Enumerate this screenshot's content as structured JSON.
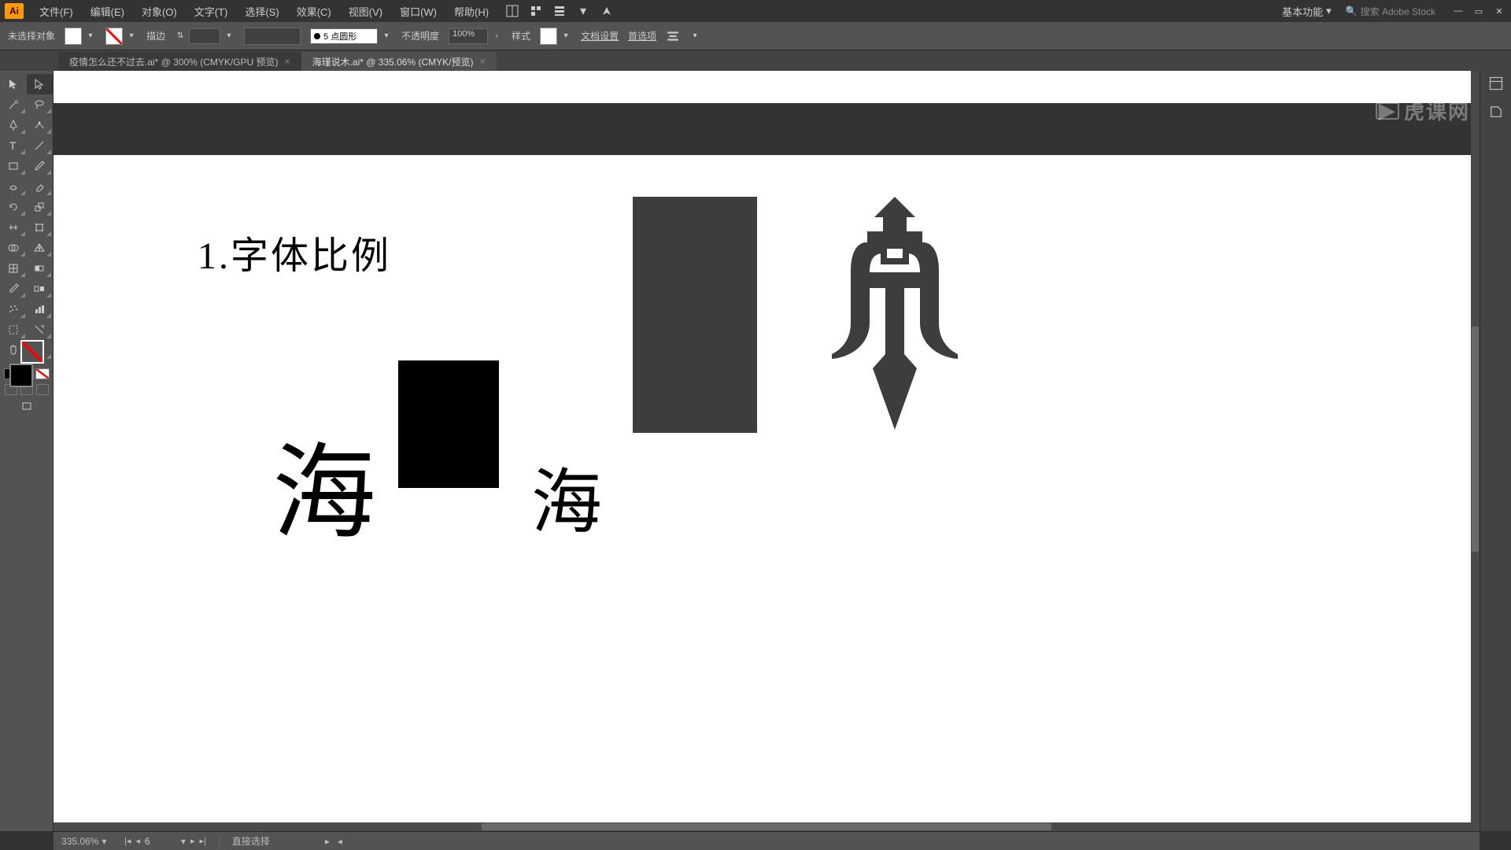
{
  "app_logo": "Ai",
  "menu": {
    "file": "文件(F)",
    "edit": "编辑(E)",
    "object": "对象(O)",
    "type": "文字(T)",
    "select": "选择(S)",
    "effect": "效果(C)",
    "view": "视图(V)",
    "window": "窗口(W)",
    "help": "帮助(H)"
  },
  "workspace": "基本功能",
  "search_placeholder": "搜索 Adobe Stock",
  "control": {
    "no_selection": "未选择对象",
    "stroke_label": "描边",
    "profile_label": "5 点圆形",
    "opacity_label": "不透明度",
    "opacity_value": "100%",
    "style_label": "样式",
    "doc_setup": "文档设置",
    "prefs": "首选项"
  },
  "tabs": {
    "tab1": "疫情怎么还不过去.ai* @ 300% (CMYK/GPU 预览)",
    "tab2": "海瑾说木.ai* @ 335.06% (CMYK/预览)"
  },
  "canvas": {
    "heading": "1.字体比例",
    "char_big": "海",
    "char_small": "海"
  },
  "status": {
    "zoom": "335.06%",
    "artboard_num": "6",
    "tool_hint": "直接选择"
  },
  "watermark": "虎课网"
}
